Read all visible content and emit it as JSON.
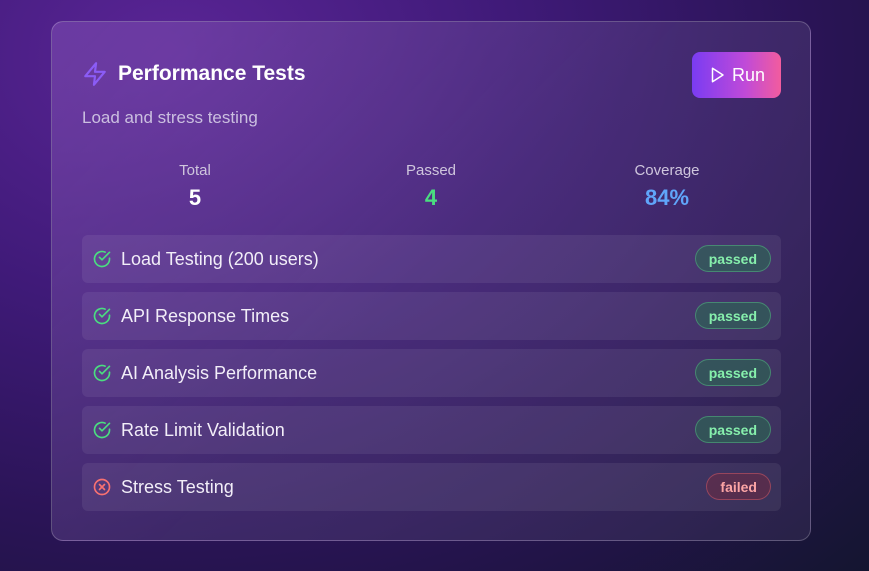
{
  "card": {
    "title": "Performance Tests",
    "subtitle": "Load and stress testing",
    "run_label": "Run",
    "icon": "zap-icon"
  },
  "stats": {
    "total": {
      "label": "Total",
      "value": "5",
      "color": "#ffffff"
    },
    "passed": {
      "label": "Passed",
      "value": "4",
      "color": "#4ade80"
    },
    "coverage": {
      "label": "Coverage",
      "value": "84%",
      "color": "#60a5fa"
    }
  },
  "tests": [
    {
      "name": "Load Testing (200 users)",
      "status": "passed"
    },
    {
      "name": "API Response Times",
      "status": "passed"
    },
    {
      "name": "AI Analysis Performance",
      "status": "passed"
    },
    {
      "name": "Rate Limit Validation",
      "status": "passed"
    },
    {
      "name": "Stress Testing",
      "status": "failed"
    }
  ],
  "colors": {
    "accent": "#8b5cf6",
    "passed": "#4ade80",
    "failed": "#f87171",
    "coverage": "#60a5fa"
  }
}
